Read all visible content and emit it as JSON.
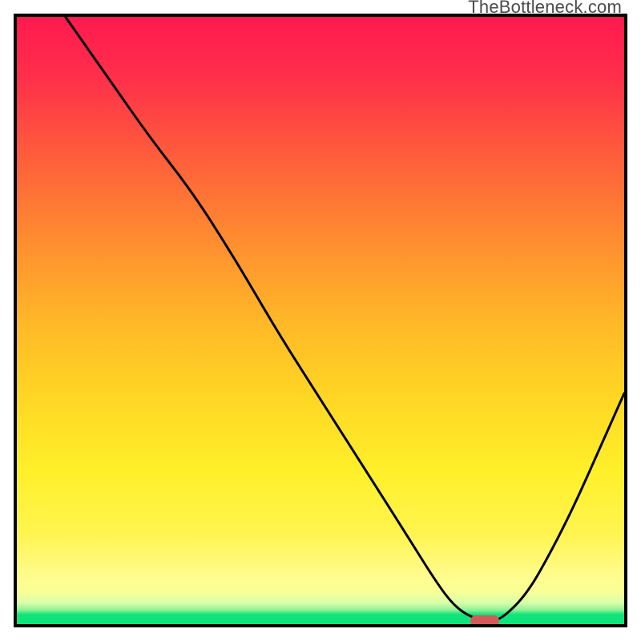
{
  "watermark": "TheBottleneck.com",
  "chart_data": {
    "type": "line",
    "title": "",
    "xlabel": "",
    "ylabel": "",
    "xlim": [
      0,
      100
    ],
    "ylim": [
      0,
      100
    ],
    "grid": false,
    "series": [
      {
        "name": "bottleneck-curve",
        "x": [
          8,
          15,
          22,
          29,
          36,
          43,
          50,
          57,
          64,
          69,
          72,
          75,
          78,
          80,
          84,
          88,
          92,
          96,
          100
        ],
        "values": [
          100,
          90,
          80,
          71,
          60,
          48,
          37,
          26,
          15,
          7,
          3,
          1,
          0.5,
          1,
          5,
          12,
          20,
          29,
          38
        ]
      }
    ],
    "optimum_marker": {
      "x": 77,
      "y": 0.5
    },
    "gradient_stops": [
      {
        "pos": 0,
        "color": "#ff1a4f"
      },
      {
        "pos": 36,
        "color": "#ff8a30"
      },
      {
        "pos": 62,
        "color": "#ffd524"
      },
      {
        "pos": 85,
        "color": "#fff44f"
      },
      {
        "pos": 98.4,
        "color": "#0fe47b"
      },
      {
        "pos": 100,
        "color": "#0fe47b"
      }
    ]
  }
}
